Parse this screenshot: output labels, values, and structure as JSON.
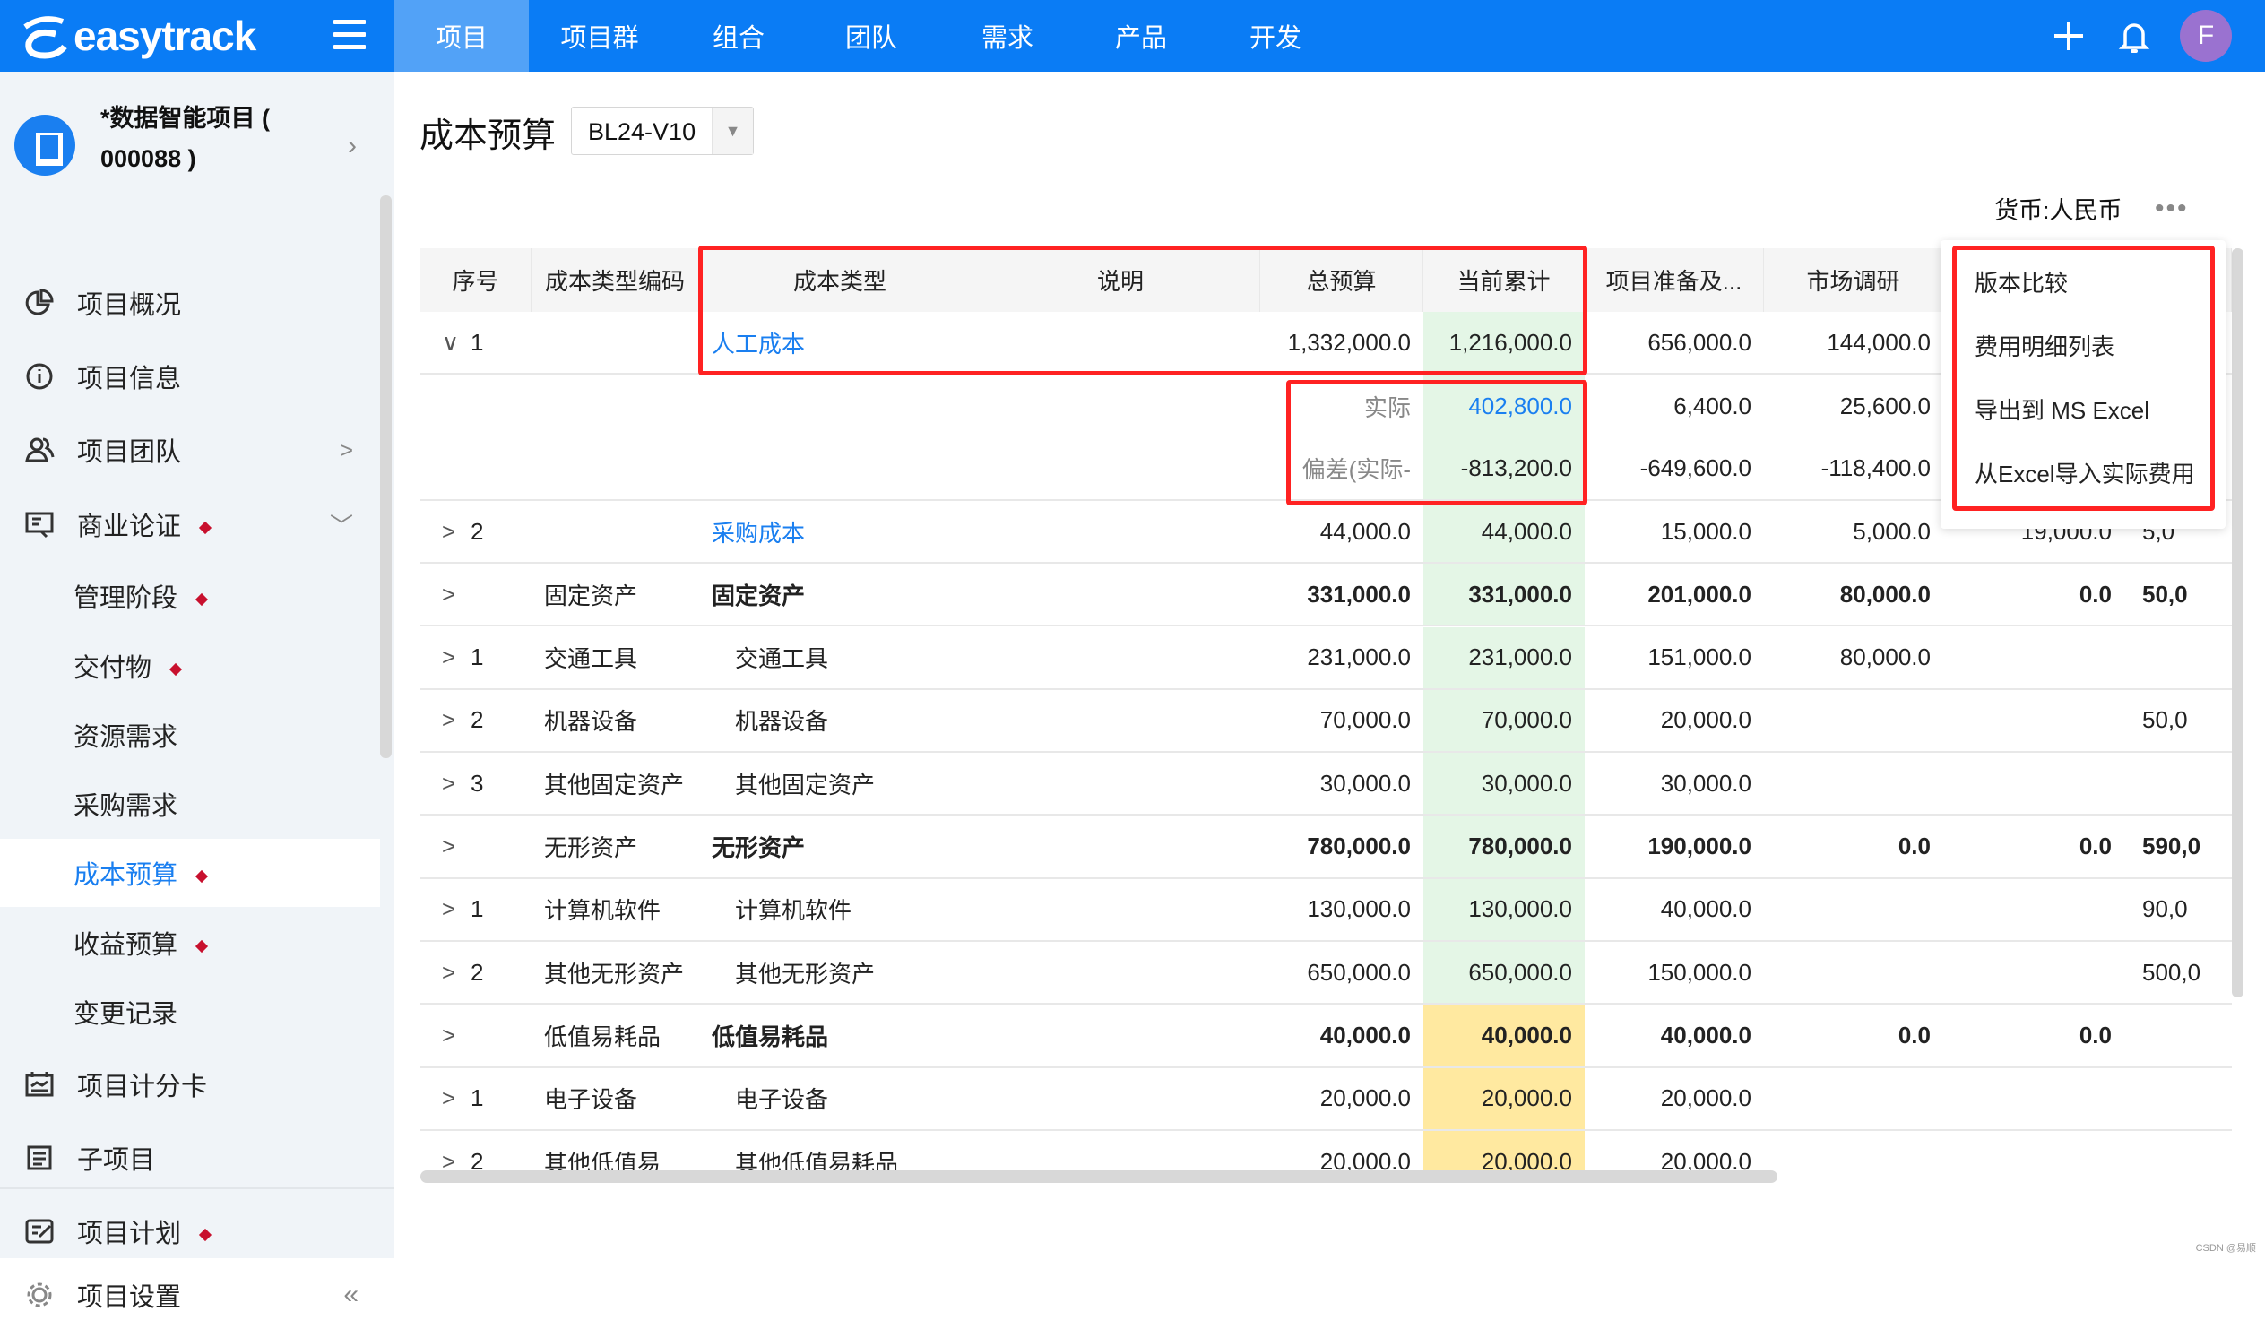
{
  "app": {
    "logo_text": "easytrack",
    "brand_color": "#0a7cf5"
  },
  "topnav": {
    "tabs": [
      {
        "label": "项目",
        "active": true
      },
      {
        "label": "项目群"
      },
      {
        "label": "组合"
      },
      {
        "label": "团队"
      },
      {
        "label": "需求"
      },
      {
        "label": "产品"
      },
      {
        "label": "开发"
      }
    ],
    "avatar_letter": "F",
    "icons": [
      "plus-icon",
      "bell-icon"
    ]
  },
  "sidebar": {
    "project_name": "*数据智能项目 ( 000088 )",
    "items": [
      {
        "label": "项目概况",
        "icon": "pie-chart-icon"
      },
      {
        "label": "项目信息",
        "icon": "info-icon"
      },
      {
        "label": "项目团队",
        "icon": "team-icon",
        "chevron": ">"
      },
      {
        "label": "商业论证",
        "icon": "business-case-icon",
        "dot": true,
        "chevron": "﹀"
      },
      {
        "label": "管理阶段",
        "sub": true,
        "dot": true
      },
      {
        "label": "交付物",
        "sub": true,
        "dot": true
      },
      {
        "label": "资源需求",
        "sub": true
      },
      {
        "label": "采购需求",
        "sub": true
      },
      {
        "label": "成本预算",
        "sub": true,
        "dot": true,
        "active": true
      },
      {
        "label": "收益预算",
        "sub": true,
        "dot": true
      },
      {
        "label": "变更记录",
        "sub": true
      },
      {
        "label": "项目计分卡",
        "icon": "scorecard-icon"
      },
      {
        "label": "子项目",
        "icon": "subproject-icon"
      },
      {
        "label": "项目计划",
        "icon": "plan-icon",
        "dot": true
      }
    ],
    "settings": {
      "label": "项目设置",
      "collapse": "«"
    }
  },
  "main": {
    "title": "成本预算",
    "version_select": {
      "value": "BL24-V10"
    },
    "currency": "货币:人民币",
    "more": "•••"
  },
  "table": {
    "headers": [
      "序号",
      "成本类型编码",
      "成本类型",
      "说明",
      "总预算",
      "当前累计",
      "项目准备及...",
      "市场调研",
      "",
      ""
    ],
    "rows": [
      {
        "exp": "∨",
        "seq": "1",
        "code": "",
        "type": "人工成本",
        "link": true,
        "desc": "",
        "vals": [
          "1,332,000.0",
          "1,216,000.0",
          "656,000.0",
          "144,000.0",
          "",
          ""
        ]
      },
      {
        "sub": true,
        "label": "实际",
        "vals": [
          "402,800.0",
          "6,400.0",
          "25,600.0",
          "",
          ""
        ]
      },
      {
        "sub": true,
        "label": "偏差(实际-",
        "vals": [
          "-813,200.0",
          "-649,600.0",
          "-118,400.0",
          "",
          ""
        ]
      },
      {
        "exp": ">",
        "seq": "2",
        "code": "",
        "type": "采购成本",
        "link": true,
        "desc": "",
        "vals": [
          "44,000.0",
          "44,000.0",
          "15,000.0",
          "5,000.0",
          "19,000.0",
          "5,0"
        ]
      },
      {
        "exp": ">",
        "seq": "",
        "code": "固定资产",
        "type": "固定资产",
        "bold": true,
        "desc": "",
        "vals": [
          "331,000.0",
          "331,000.0",
          "201,000.0",
          "80,000.0",
          "0.0",
          "50,0"
        ]
      },
      {
        "exp": ">",
        "seq": "1",
        "code": "交通工具",
        "type": "交通工具",
        "indent": true,
        "desc": "",
        "vals": [
          "231,000.0",
          "231,000.0",
          "151,000.0",
          "80,000.0",
          "",
          ""
        ]
      },
      {
        "exp": ">",
        "seq": "2",
        "code": "机器设备",
        "type": "机器设备",
        "indent": true,
        "desc": "",
        "vals": [
          "70,000.0",
          "70,000.0",
          "20,000.0",
          "",
          "",
          "50,0"
        ]
      },
      {
        "exp": ">",
        "seq": "3",
        "code": "其他固定资产",
        "type": "其他固定资产",
        "indent": true,
        "desc": "",
        "vals": [
          "30,000.0",
          "30,000.0",
          "30,000.0",
          "",
          "",
          ""
        ]
      },
      {
        "exp": ">",
        "seq": "",
        "code": "无形资产",
        "type": "无形资产",
        "bold": true,
        "desc": "",
        "vals": [
          "780,000.0",
          "780,000.0",
          "190,000.0",
          "0.0",
          "0.0",
          "590,0"
        ]
      },
      {
        "exp": ">",
        "seq": "1",
        "code": "计算机软件",
        "type": "计算机软件",
        "indent": true,
        "desc": "",
        "vals": [
          "130,000.0",
          "130,000.0",
          "40,000.0",
          "",
          "",
          "90,0"
        ]
      },
      {
        "exp": ">",
        "seq": "2",
        "code": "其他无形资产",
        "type": "其他无形资产",
        "indent": true,
        "desc": "",
        "vals": [
          "650,000.0",
          "650,000.0",
          "150,000.0",
          "",
          "",
          "500,0"
        ]
      },
      {
        "exp": ">",
        "seq": "",
        "code": "低值易耗品",
        "type": "低值易耗品",
        "bold": true,
        "yellow": true,
        "desc": "",
        "vals": [
          "40,000.0",
          "40,000.0",
          "40,000.0",
          "0.0",
          "0.0",
          ""
        ]
      },
      {
        "exp": ">",
        "seq": "1",
        "code": "电子设备",
        "type": "电子设备",
        "indent": true,
        "yellow": true,
        "desc": "",
        "vals": [
          "20,000.0",
          "20,000.0",
          "20,000.0",
          "",
          "",
          ""
        ]
      },
      {
        "exp": ">",
        "seq": "2",
        "code": "其他低值易",
        "type": "其他低值易耗品",
        "indent": true,
        "yellow": true,
        "desc": "",
        "vals": [
          "20,000.0",
          "20,000.0",
          "20,000.0",
          "",
          "",
          ""
        ]
      }
    ],
    "highlight_colors": {
      "current_total": "#e4f6e6",
      "low_value": "#ffe9a0"
    }
  },
  "context_menu": {
    "items": [
      "版本比较",
      "费用明细列表",
      "导出到 MS Excel",
      "从Excel导入实际费用"
    ]
  },
  "watermark": "CSDN @易顺"
}
